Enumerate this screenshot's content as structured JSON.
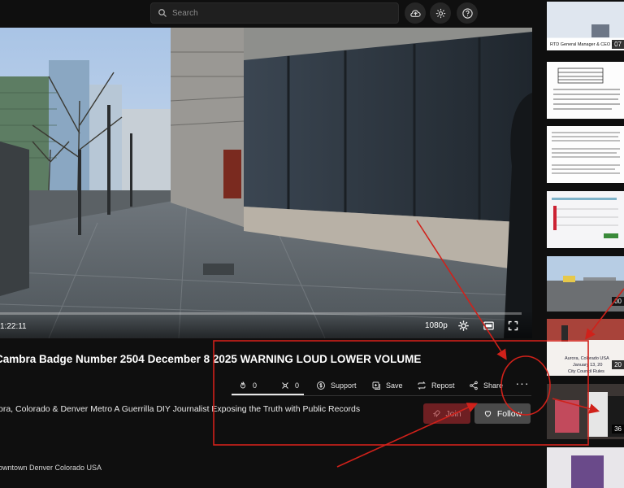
{
  "search": {
    "placeholder": "Search"
  },
  "header_icons": [
    "upload-icon",
    "gear-icon",
    "help-icon"
  ],
  "player": {
    "time": "1:22:11",
    "quality": "1080p"
  },
  "video": {
    "title": "Cambra Badge Number 2504 December 8 2025 WARNING LOUD LOWER VOLUME",
    "channel_description": "ora, Colorado & Denver Metro A Guerrilla DIY Journalist Exposing the Truth with Public Records",
    "location": "owntown Denver Colorado USA"
  },
  "actions": {
    "likes": "0",
    "dislikes": "0",
    "support": "Support",
    "save": "Save",
    "repost": "Repost",
    "share": "Share",
    "more": "···"
  },
  "buttons": {
    "join": "Join",
    "follow": "Follow"
  },
  "sidebar": {
    "thumbnails": [
      {
        "duration": "07",
        "caption": "RTD General Manager & CEO Deb"
      },
      {
        "duration": ""
      },
      {
        "duration": ""
      },
      {
        "duration": ""
      },
      {
        "duration": "00"
      },
      {
        "duration": "20",
        "caption": "Aurora, Colorado USA"
      },
      {
        "duration": "36"
      },
      {
        "duration": ""
      }
    ],
    "thumb_texts": {
      "t6_line2": "January 13, 20",
      "t6_line3": "City Council Rules"
    }
  },
  "colors": {
    "annotation": "#d0211a",
    "join_bg": "#6e1f22",
    "follow_bg": "#4a4a4a",
    "background": "#0f0f0f"
  }
}
